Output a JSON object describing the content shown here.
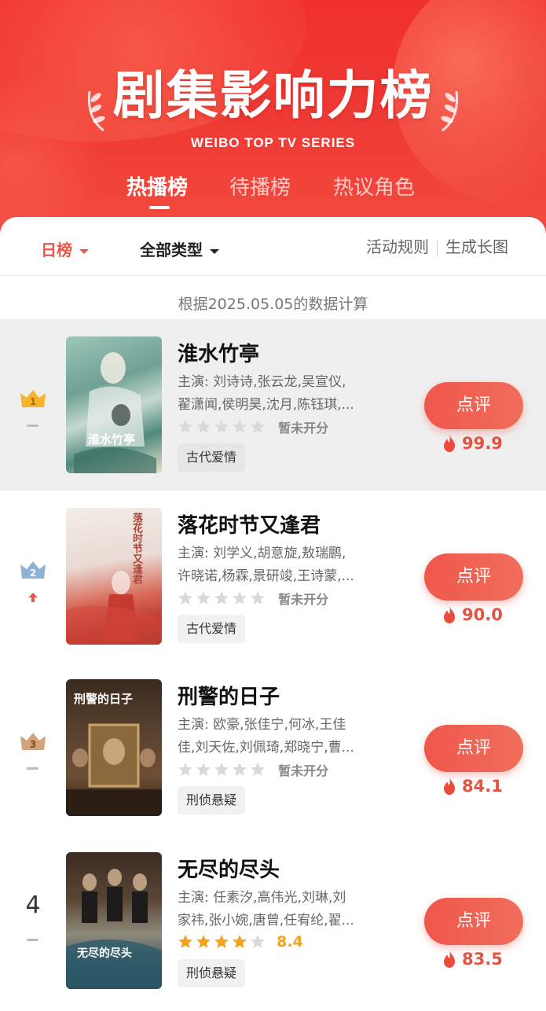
{
  "header": {
    "title": "剧集影响力榜",
    "subtitle": "WEIBO TOP TV SERIES",
    "tabs": [
      {
        "label": "热播榜",
        "active": true
      },
      {
        "label": "待播榜",
        "active": false
      },
      {
        "label": "热议角色",
        "active": false
      }
    ]
  },
  "filters": {
    "period": "日榜",
    "type": "全部类型",
    "rules": "活动规则",
    "image": "生成长图"
  },
  "note": "根据2025.05.05的数据计算",
  "colors": {
    "accent": "#ef3b35",
    "button": "#f0574c",
    "gold": "#f4a21a",
    "heat": "#e35243"
  },
  "items": [
    {
      "rank": "1",
      "rank_change": "none",
      "title": "淮水竹亭",
      "cast_line1": "主演: 刘诗诗,张云龙,吴宣仪,",
      "cast_line2": "翟潇闻,侯明昊,沈月,陈钰琪,...",
      "rating_stars": 0,
      "rating_text": "暂未开分",
      "tag": "古代爱情",
      "button": "点评",
      "heat": "99.9",
      "poster_caption": "淮水竹亭"
    },
    {
      "rank": "2",
      "rank_change": "up",
      "title": "落花时节又逢君",
      "cast_line1": "主演: 刘学义,胡意旋,敖瑞鹏,",
      "cast_line2": "许晓诺,杨霖,景研竣,王诗蒙,...",
      "rating_stars": 0,
      "rating_text": "暂未开分",
      "tag": "古代爱情",
      "button": "点评",
      "heat": "90.0",
      "poster_caption": "落花时节又逢君"
    },
    {
      "rank": "3",
      "rank_change": "none",
      "title": "刑警的日子",
      "cast_line1": "主演: 欧豪,张佳宁,何冰,王佳",
      "cast_line2": "佳,刘天佐,刘佩琦,郑晓宁,曹...",
      "rating_stars": 0,
      "rating_text": "暂未开分",
      "tag": "刑侦悬疑",
      "button": "点评",
      "heat": "84.1",
      "poster_caption": "刑警的日子"
    },
    {
      "rank": "4",
      "rank_change": "none",
      "title": "无尽的尽头",
      "cast_line1": "主演: 任素汐,高伟光,刘琳,刘",
      "cast_line2": "家祎,张小婉,唐曾,任宥纶,翟...",
      "rating_stars": 4,
      "rating_text": "8.4",
      "tag": "刑侦悬疑",
      "button": "点评",
      "heat": "83.5",
      "poster_caption": "无尽的尽头"
    }
  ]
}
